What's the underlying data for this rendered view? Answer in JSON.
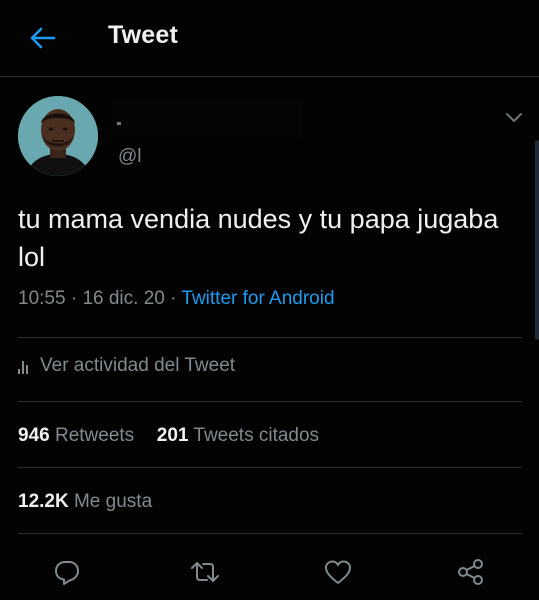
{
  "header": {
    "title": "Tweet"
  },
  "author": {
    "handle": "@l"
  },
  "tweet": {
    "text": "tu mama vendia nudes y tu papa jugaba lol",
    "time": "10:55",
    "separator": "·",
    "date": "16 dic. 20",
    "source": "Twitter for Android"
  },
  "activity": {
    "label": "Ver actividad del Tweet"
  },
  "stats": {
    "retweets_count": "946",
    "retweets_label": "Retweets",
    "quotes_count": "201",
    "quotes_label": "Tweets citados",
    "likes_count": "12.2K",
    "likes_label": "Me gusta"
  },
  "icons": {
    "back": "arrow-left-icon",
    "more": "chevron-down-icon",
    "reply": "reply-icon",
    "retweet": "retweet-icon",
    "like": "heart-icon",
    "share": "share-icon",
    "activity": "bar-chart-icon"
  },
  "colors": {
    "background": "#030303",
    "accent": "#1d9bf0",
    "text_primary": "#eef1f2",
    "text_secondary": "#818a8f",
    "divider": "#2b2e30"
  }
}
